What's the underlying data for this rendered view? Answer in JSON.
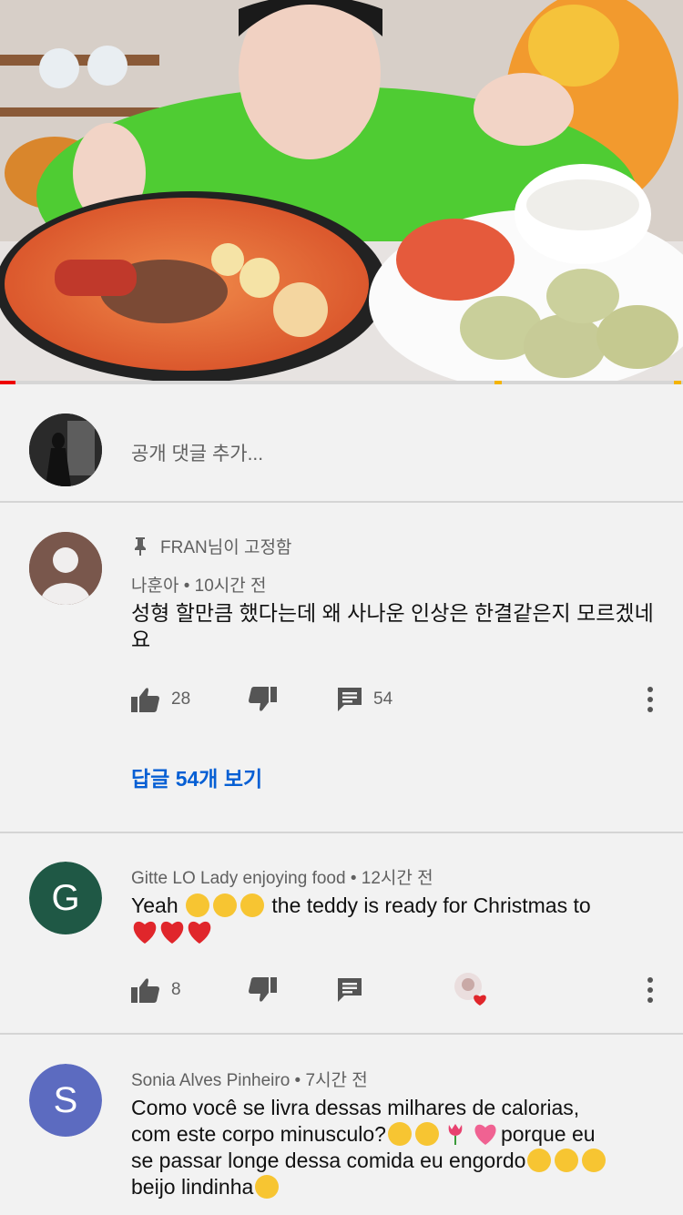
{
  "video": {
    "progress_fraction": 0.023
  },
  "add_comment": {
    "placeholder": "공개 댓글 추가..."
  },
  "comments": [
    {
      "pinned_label": "FRAN님이 고정함",
      "author": "나훈아",
      "time": "10시간 전",
      "text": "성형 할만큼 했다는데  왜  사나운  인상은 한결같은지 모르겠네요",
      "likes": "28",
      "reply_count": "54",
      "view_replies": "답글 54개 보기"
    },
    {
      "avatar_letter": "G",
      "avatar_color": "#1f5845",
      "author": "Gitte LO Lady enjoying food",
      "time": "12시간 전",
      "text_a": "Yeah",
      "text_b": "the teddy is ready for Christmas to",
      "likes": "8"
    },
    {
      "avatar_letter": "S",
      "avatar_color": "#5c6bc0",
      "author": "Sonia Alves Pinheiro",
      "time": "7시간 전",
      "line1": "Como você se livra dessas milhares de calorias,",
      "line2a": "com este corpo minusculo?",
      "line2b": "porque eu",
      "line3": "se passar longe dessa comida eu engordo",
      "line4": "beijo lindinha"
    }
  ],
  "colors": {
    "link": "#065fd4",
    "progress_played": "#ee0000",
    "ad_marker": "#f4b400"
  },
  "separator": " • "
}
